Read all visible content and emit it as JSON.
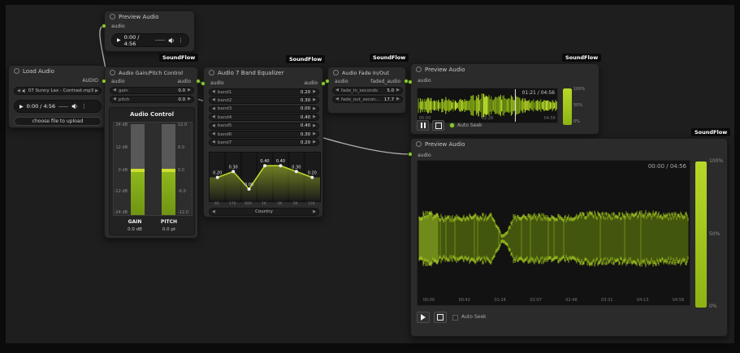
{
  "badge_label": "SoundFlow",
  "colors": {
    "accent_green": "#8cc63f",
    "wave_green": "#a9cc21",
    "meter_green": "#8fb81c",
    "meter_cap": "#cddf2f"
  },
  "nodes": {
    "preview_top": {
      "title": "Preview Audio",
      "input_label": "audio",
      "time": "0:00 / 4:56"
    },
    "load_audio": {
      "title": "Load Audio",
      "output_label": "AUDIO",
      "file_name": "07 Sunny Lax - Contrast.mp3",
      "time": "0:00 / 4:56",
      "upload_label": "choose file to upload"
    },
    "gain_pitch": {
      "title": "Audio Gain/Pitch Control",
      "input_label": "audio",
      "output_label": "audio",
      "widgets": [
        {
          "name": "gain",
          "value": "0.0"
        },
        {
          "name": "pitch",
          "value": "0.0"
        }
      ],
      "panel": {
        "title": "Audio Control",
        "gain_ticks": [
          "24 dB",
          "12 dB",
          "0 dB",
          "-12 dB",
          "-24 dB"
        ],
        "pitch_ticks": [
          "12.0",
          "6.0",
          "0.0",
          "-6.0",
          "-12.0"
        ],
        "meters": [
          {
            "label": "GAIN",
            "value": "0.0 dB"
          },
          {
            "label": "PITCH",
            "value": "0.0 pt"
          }
        ]
      }
    },
    "equalizer": {
      "title": "Audio 7 Band Equalizer",
      "input_label": "audio",
      "output_label": "audio",
      "bands": [
        {
          "name": "band1",
          "value": "0.20"
        },
        {
          "name": "band2",
          "value": "0.30"
        },
        {
          "name": "band3",
          "value": "0.00"
        },
        {
          "name": "band4",
          "value": "0.40"
        },
        {
          "name": "band5",
          "value": "0.40"
        },
        {
          "name": "band6",
          "value": "0.30"
        },
        {
          "name": "band7",
          "value": "0.20"
        }
      ],
      "preset": "Country"
    },
    "fade": {
      "title": "Audio Fade In/Out",
      "input_label": "audio",
      "output_label": "faded_audio",
      "widgets": [
        {
          "name": "fade_in_seconds",
          "value": "5.0"
        },
        {
          "name": "fade_out_secon...",
          "value": "17.7"
        }
      ]
    },
    "preview_small": {
      "title": "Preview Audio",
      "input_label": "audio",
      "time_display": "01:21 / 04:56",
      "timeline": [
        "00:00",
        "02:28",
        "04:56"
      ],
      "volume_ticks": [
        "100%",
        "50%",
        "0%"
      ],
      "auto_seek_label": "Auto Seek",
      "playhead_pct": 70
    },
    "preview_big": {
      "title": "Preview Audio",
      "input_label": "audio",
      "time_display": "00:00 / 04:56",
      "timeline": [
        "00:00",
        "00:42",
        "01:24",
        "02:07",
        "02:48",
        "03:31",
        "04:13",
        "04:56"
      ],
      "volume_ticks": [
        "100%",
        "50%",
        "0%"
      ],
      "auto_seek_label": "Auto Seek"
    }
  },
  "chart_data": {
    "type": "line",
    "categories": [
      "60",
      "170",
      "600",
      "1K",
      "3K",
      "6K",
      "12K"
    ],
    "values": [
      0.2,
      0.3,
      0.0,
      0.4,
      0.4,
      0.3,
      0.2
    ],
    "point_labels": [
      "0.20",
      "0.30",
      "0.00",
      "0.40",
      "0.40",
      "0.30",
      "0.20"
    ],
    "title": "",
    "xlabel": "",
    "ylabel": "",
    "ylim": [
      -0.2,
      0.7
    ],
    "grid": "vertical",
    "legend": false
  },
  "waveforms": {
    "small": {
      "envelope": [
        [
          0,
          0.5
        ],
        [
          14,
          0.55
        ],
        [
          26,
          0.4
        ],
        [
          36,
          0.6
        ],
        [
          48,
          0.3
        ],
        [
          58,
          0.65
        ],
        [
          78,
          0.8
        ],
        [
          98,
          0.7
        ],
        [
          116,
          0.85
        ],
        [
          128,
          0.55
        ],
        [
          140,
          0.4
        ],
        [
          152,
          0.5
        ],
        [
          162,
          0.35
        ],
        [
          174,
          0.4
        ]
      ]
    },
    "big": {
      "envelope": [
        [
          0,
          0
        ],
        [
          2,
          0.85
        ],
        [
          12,
          0.95
        ],
        [
          30,
          0.8
        ],
        [
          60,
          0.82
        ],
        [
          90,
          0.85
        ],
        [
          98,
          0.5
        ],
        [
          104,
          0.14
        ],
        [
          110,
          0.25
        ],
        [
          118,
          0.8
        ],
        [
          150,
          0.85
        ],
        [
          185,
          0.8
        ],
        [
          215,
          0.92
        ],
        [
          245,
          0.85
        ],
        [
          275,
          0.95
        ],
        [
          305,
          0.88
        ],
        [
          330,
          0.9
        ],
        [
          334,
          0.85
        ],
        [
          337,
          0
        ]
      ]
    }
  }
}
